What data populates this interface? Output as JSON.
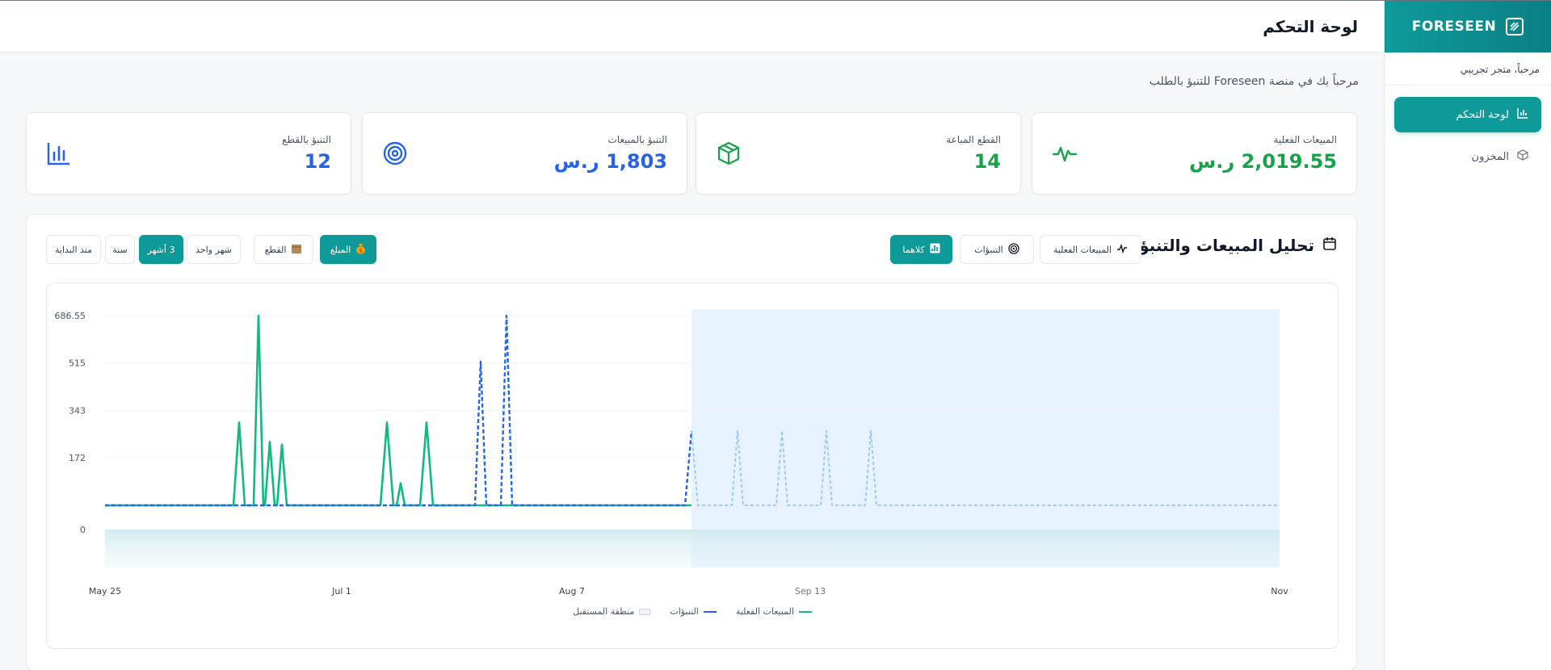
{
  "sidebar": {
    "brand": "FORESEEN",
    "greeting": "مرحباً، متجر تجريبي",
    "items": [
      {
        "label": "لوحة التحكم",
        "icon": "bar-chart-icon",
        "active": true
      },
      {
        "label": "المخزون",
        "icon": "box-icon",
        "active": false
      }
    ]
  },
  "header": {
    "title": "لوحة التحكم"
  },
  "welcome": "مرحباً بك في منصة Foreseen للتنبؤ بالطلب",
  "cards": [
    {
      "label": "المبيعات الفعلية",
      "value": "2,019.55 ر.س",
      "icon": "activity-icon",
      "color": "#16a34a"
    },
    {
      "label": "القطع المباعة",
      "value": "14",
      "icon": "package-icon",
      "color": "#16a34a"
    },
    {
      "label": "التنبؤ بالمبيعات",
      "value": "1,803 ر.س",
      "icon": "target-icon",
      "color": "#2563eb"
    },
    {
      "label": "التنبؤ بالقطع",
      "value": "12",
      "icon": "bar-chart-icon",
      "color": "#2563eb"
    }
  ],
  "panel": {
    "title": "تحليل المبيعات والتنبؤات",
    "view_buttons": {
      "actual": "المبيعات الفعلية",
      "forecast": "التنبؤات",
      "both": "كلاهما"
    },
    "metric_buttons": {
      "amount": "المبلغ",
      "units": "القطع"
    },
    "range_buttons": {
      "month": "شهر واحد",
      "three_months": "3 أشهر",
      "year": "سنة",
      "all": "منذ البداية"
    }
  },
  "chart_data": {
    "type": "line",
    "yticks": [
      "686.55",
      "515",
      "343",
      "172",
      "0"
    ],
    "ylim": [
      0,
      686.55
    ],
    "xticks": [
      "May 25",
      "Jul 1",
      "Aug 7",
      "Sep 13",
      "Nov 25"
    ],
    "legend": {
      "actual": "المبيعات الفعلية",
      "forecast": "التنبؤات",
      "future": "منطقة المستقبل"
    },
    "colors": {
      "actual": "#10b981",
      "forecast": "#2563eb",
      "future": "#dbeafe"
    },
    "actual_peaks": [
      300,
      686,
      230,
      220,
      300,
      80,
      300
    ],
    "forecast_peaks": [
      520,
      686,
      270
    ],
    "future_forecast_peaks": [
      270,
      270,
      270,
      270
    ]
  }
}
